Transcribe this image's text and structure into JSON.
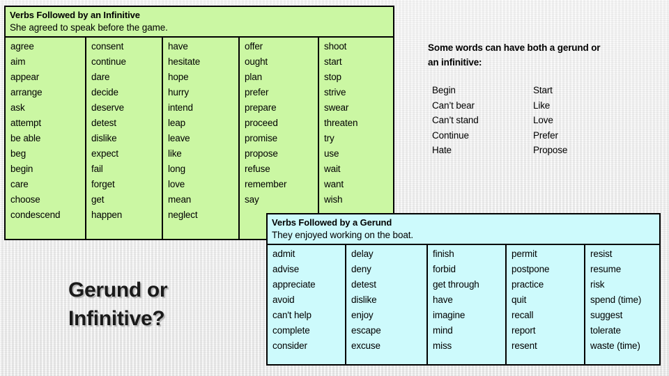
{
  "background": {
    "color": "#f4f4f4"
  },
  "slide_title": {
    "line1": "Gerund or",
    "line2": "Infinitive?"
  },
  "infinitive_table": {
    "accent_color": "#cbf7a3",
    "header": {
      "title": "Verbs Followed by an Infinitive",
      "example": "She agreed to speak before the game."
    },
    "columns": [
      [
        "agree",
        "aim",
        "appear",
        "arrange",
        "ask",
        "attempt",
        "be able",
        "beg",
        "begin",
        "care",
        "choose",
        "condescend"
      ],
      [
        "consent",
        "continue",
        "dare",
        "decide",
        "deserve",
        "detest",
        "dislike",
        "expect",
        "fail",
        "forget",
        "get",
        "happen"
      ],
      [
        "have",
        "hesitate",
        "hope",
        "hurry",
        "intend",
        "leap",
        "leave",
        "like",
        "long",
        "love",
        "mean",
        "neglect"
      ],
      [
        "offer",
        "ought",
        "plan",
        "prefer",
        "prepare",
        "proceed",
        "promise",
        "propose",
        "refuse",
        "remember",
        "say"
      ],
      [
        "shoot",
        "start",
        "stop",
        "strive",
        "swear",
        "threaten",
        "try",
        "use",
        "wait",
        "want",
        "wish"
      ]
    ]
  },
  "gerund_table": {
    "accent_color": "#cdfafc",
    "header": {
      "title": "Verbs Followed by a Gerund",
      "example": "They enjoyed working on the boat."
    },
    "columns": [
      [
        "admit",
        "advise",
        "appreciate",
        "avoid",
        "can't help",
        "complete",
        "consider"
      ],
      [
        "delay",
        "deny",
        "detest",
        "dislike",
        "enjoy",
        "escape",
        "excuse"
      ],
      [
        "finish",
        "forbid",
        "get through",
        "have",
        "imagine",
        "mind",
        "miss"
      ],
      [
        "permit",
        "postpone",
        "practice",
        "quit",
        "recall",
        "report",
        "resent"
      ],
      [
        "resist",
        "resume",
        "risk",
        "spend (time)",
        "suggest",
        "tolerate",
        "waste (time)"
      ]
    ]
  },
  "both_panel": {
    "heading_line1": "Some words can have both a gerund or",
    "heading_line2": "an infinitive:",
    "columns": [
      [
        "Begin",
        "Can’t bear",
        "Can’t stand",
        "Continue",
        "Hate"
      ],
      [
        "Start",
        "Like",
        "Love",
        "Prefer",
        "Propose"
      ]
    ]
  }
}
